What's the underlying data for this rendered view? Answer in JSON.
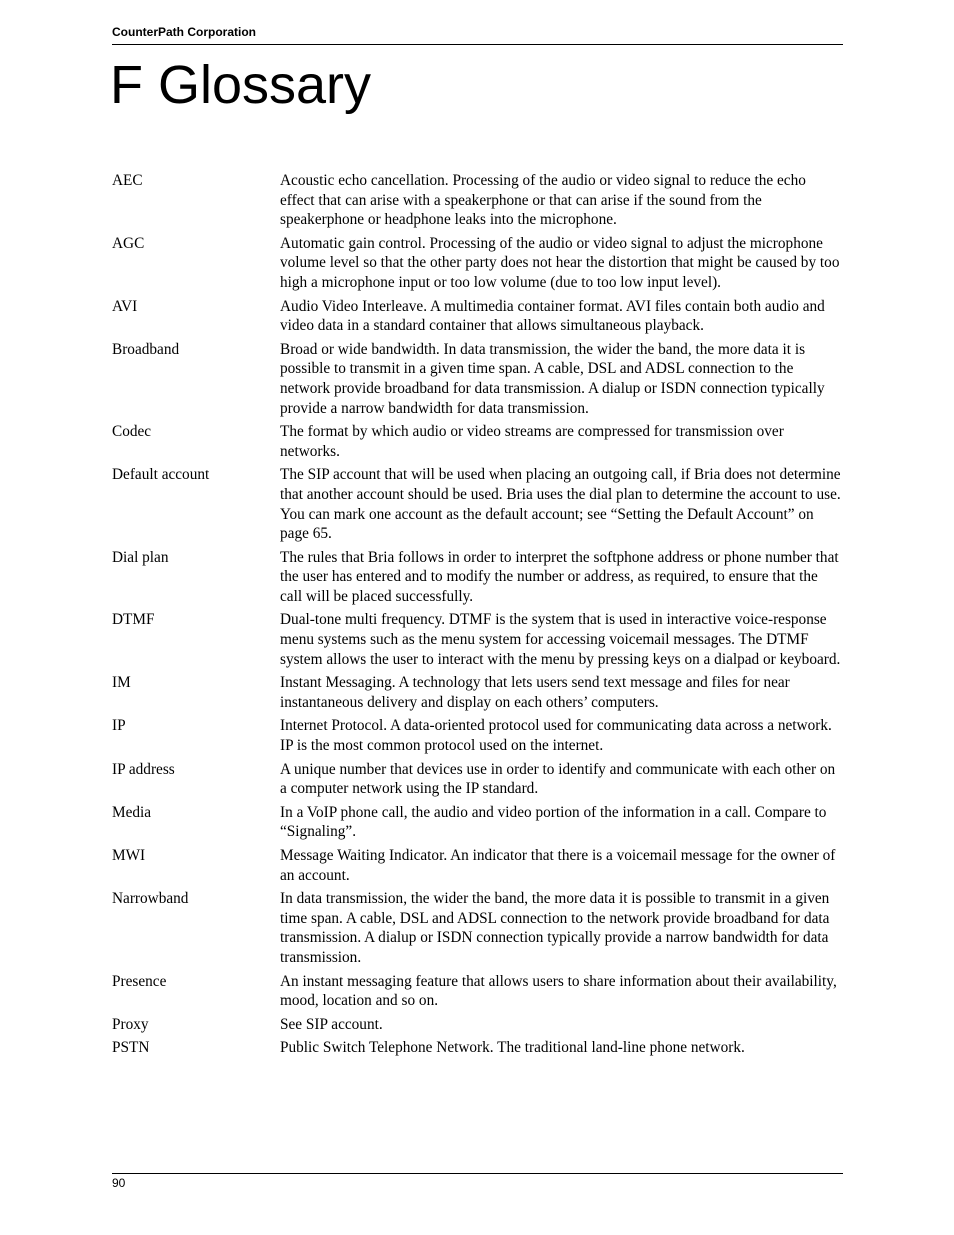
{
  "header": {
    "company": "CounterPath Corporation"
  },
  "title": "F Glossary",
  "glossary": [
    {
      "term": "AEC",
      "definition": "Acoustic echo cancellation. Processing of the audio or video signal to reduce the echo effect that can arise with a speakerphone or that can arise if the sound from the speakerphone or headphone leaks into the microphone."
    },
    {
      "term": "AGC",
      "definition": "Automatic gain control. Processing of the audio or video signal to adjust the microphone volume level so that the other party does not hear the distortion that might be caused by too high a microphone input or too low volume (due to too low input level)."
    },
    {
      "term": "AVI",
      "definition": "Audio Video Interleave. A multimedia container format. AVI files contain both audio and video data in a standard container that allows simultaneous playback."
    },
    {
      "term": "Broadband",
      "definition": "Broad or wide bandwidth. In data transmission, the wider the band, the more data it is possible to transmit in a given time span. A cable, DSL and ADSL connection to the network provide broadband for data transmission. A dialup or ISDN connection typically provide a narrow bandwidth for data transmission."
    },
    {
      "term": "Codec",
      "definition": "The format by which audio or video streams are compressed for transmission over networks."
    },
    {
      "term": "Default account",
      "definition": "The SIP account that will be used when placing an outgoing call, if Bria does not determine that another account should be used. Bria uses the dial plan to determine the account to use.  You can mark one account as the default account; see “Setting the Default Account” on page 65."
    },
    {
      "term": "Dial plan",
      "definition": "The rules that Bria follows in order to interpret the softphone address or phone number that the user has entered and to modify the number or address, as required, to ensure that the call will be placed successfully."
    },
    {
      "term": "DTMF",
      "definition": "Dual-tone multi frequency. DTMF is the system that is used in interactive voice-response menu systems such as the menu system for accessing voicemail messages. The DTMF system allows the user to interact with the menu by pressing keys on a dialpad or keyboard."
    },
    {
      "term": "IM",
      "definition": "Instant Messaging. A technology that lets users send text message and files for near instantaneous delivery and display on each others’ computers."
    },
    {
      "term": "IP",
      "definition": "Internet Protocol. A data-oriented protocol used for communicating data across a network. IP is the most common protocol used on the internet."
    },
    {
      "term": "IP address",
      "definition": "A unique number that devices use in order to identify and communicate with each other on a computer network using the IP standard."
    },
    {
      "term": "Media",
      "definition": "In a VoIP phone call, the audio and video portion of the information in a call. Compare to “Signaling”."
    },
    {
      "term": "MWI",
      "definition": "Message Waiting Indicator. An indicator that there is a voicemail message for the owner of an account."
    },
    {
      "term": "Narrowband",
      "definition": "In data transmission, the wider the band, the more data it is possible to transmit in a given time span. A cable, DSL and ADSL connection to the network provide broadband for data transmission. A dialup or ISDN connection typically provide a narrow bandwidth for data transmission."
    },
    {
      "term": "Presence",
      "definition": "An instant messaging feature that allows users to share information about their availability, mood, location and so on."
    },
    {
      "term": "Proxy",
      "definition": "See SIP account."
    },
    {
      "term": "PSTN",
      "definition": "Public Switch Telephone Network. The traditional land-line phone network."
    }
  ],
  "footer": {
    "page_number": "90"
  }
}
